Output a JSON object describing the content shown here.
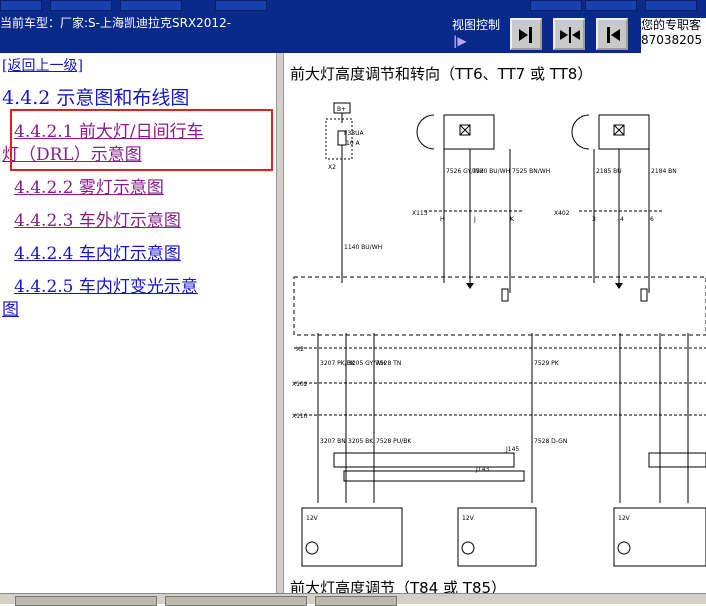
{
  "header": {
    "title": "当前车型：厂家:S-上海凯迪拉克SRX2012-",
    "view_control_label": "视图控制",
    "view_arrow": "|▶",
    "expert_line1": "您的专职客",
    "expert_line2": "87038205"
  },
  "nav": {
    "back": "[返回上一级]",
    "section": "4.4.2 示意图和布线图",
    "items": [
      {
        "line1": "4.4.2.1 前大灯/日间行车",
        "line2": "灯（DRL）示意图"
      },
      {
        "line1": "4.4.2.2 雾灯示意图"
      },
      {
        "line1": "4.4.2.3 车外灯示意图"
      },
      {
        "line1": "4.4.2.4 车内灯示意图"
      },
      {
        "line1": "4.4.2.5 车内灯变光示意",
        "line2": "图"
      }
    ]
  },
  "diagram": {
    "title1": "前大灯高度调节和转向（TT6、TT7 或 TT8）",
    "title2": "前大灯高度调节（T84 或 T85）",
    "labels": {
      "bplus": "B+",
      "fuse": "F38UA",
      "fuse_amp": "10 A",
      "conn_x2": "X2",
      "conn_x113": "X113",
      "conn_x402": "X402",
      "conn_x102": "X102",
      "conn_x110": "X110",
      "j145": "J145",
      "j143": "J143",
      "v12a": "12V",
      "v12b": "12V",
      "v12c": "12V",
      "pin_h": "H",
      "pin_j": "J",
      "pin_k": "K",
      "pin_3": "3",
      "pin_4": "4",
      "pin_6": "6",
      "w1": "7526 GY/WH",
      "w2": "7520 BU/WH",
      "w3": "7525 BN/WH",
      "w4": "2185 BU",
      "w5": "2184 BN",
      "w6": "1140 BU/WH",
      "w7": "3207 PK/BK",
      "w8": "3205 GY/WH",
      "w9": "7528 TN",
      "w10": "7529 PK",
      "w11": "3207 BN",
      "w12": "3205 BK",
      "w13": "7528 PU/BK",
      "w14": "7528 D-GN"
    }
  }
}
